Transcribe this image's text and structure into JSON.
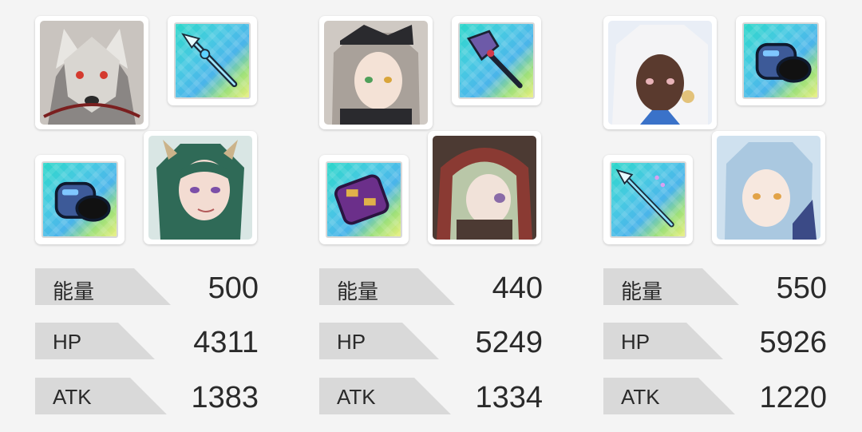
{
  "teams": [
    {
      "portraits": [
        {
          "name": "wolf-knight-portrait",
          "colors": {
            "bg": "#c9c4bf",
            "hair": "#e8e6e2",
            "skin": "#8a8684",
            "accent": "#d43a2e"
          }
        },
        {
          "name": "green-haired-horned-portrait",
          "colors": {
            "bg": "#d9e6e4",
            "hair": "#2f6a57",
            "skin": "#f3dcd2",
            "accent": "#cbb38a"
          }
        }
      ],
      "weapons": [
        {
          "name": "spear-weapon-icon"
        },
        {
          "name": "gauntlet-weapon-icon"
        }
      ],
      "stats": {
        "energy": {
          "label": "能量",
          "value": "500"
        },
        "hp": {
          "label": "HP",
          "value": "4311"
        },
        "atk": {
          "label": "ATK",
          "value": "1383"
        }
      }
    },
    {
      "portraits": [
        {
          "name": "grey-haired-cat-portrait",
          "colors": {
            "bg": "#cfc9c3",
            "hair": "#a9a19a",
            "skin": "#f4e2d6",
            "accent": "#2a2a2e"
          }
        },
        {
          "name": "hooded-green-haired-portrait",
          "colors": {
            "bg": "#4c3a33",
            "hair": "#b9c7a8",
            "skin": "#f1e2d9",
            "accent": "#8a3a33"
          }
        }
      ],
      "weapons": [
        {
          "name": "axe-weapon-icon"
        },
        {
          "name": "purple-gauntlet-weapon-icon"
        }
      ],
      "stats": {
        "energy": {
          "label": "能量",
          "value": "440"
        },
        "hp": {
          "label": "HP",
          "value": "5249"
        },
        "atk": {
          "label": "ATK",
          "value": "1334"
        }
      }
    },
    {
      "portraits": [
        {
          "name": "white-haired-dark-skin-portrait",
          "colors": {
            "bg": "#e9eef6",
            "hair": "#f4f4f6",
            "skin": "#5a3a2e",
            "accent": "#3a72c9"
          }
        },
        {
          "name": "light-blue-haired-portrait",
          "colors": {
            "bg": "#cfe1ef",
            "hair": "#aac8e0",
            "skin": "#f7e8df",
            "accent": "#e2a348"
          }
        }
      ],
      "weapons": [
        {
          "name": "gauntlet-weapon-icon"
        },
        {
          "name": "spear-weapon-icon"
        }
      ],
      "stats": {
        "energy": {
          "label": "能量",
          "value": "550"
        },
        "hp": {
          "label": "HP",
          "value": "5926"
        },
        "atk": {
          "label": "ATK",
          "value": "1220"
        }
      }
    }
  ]
}
